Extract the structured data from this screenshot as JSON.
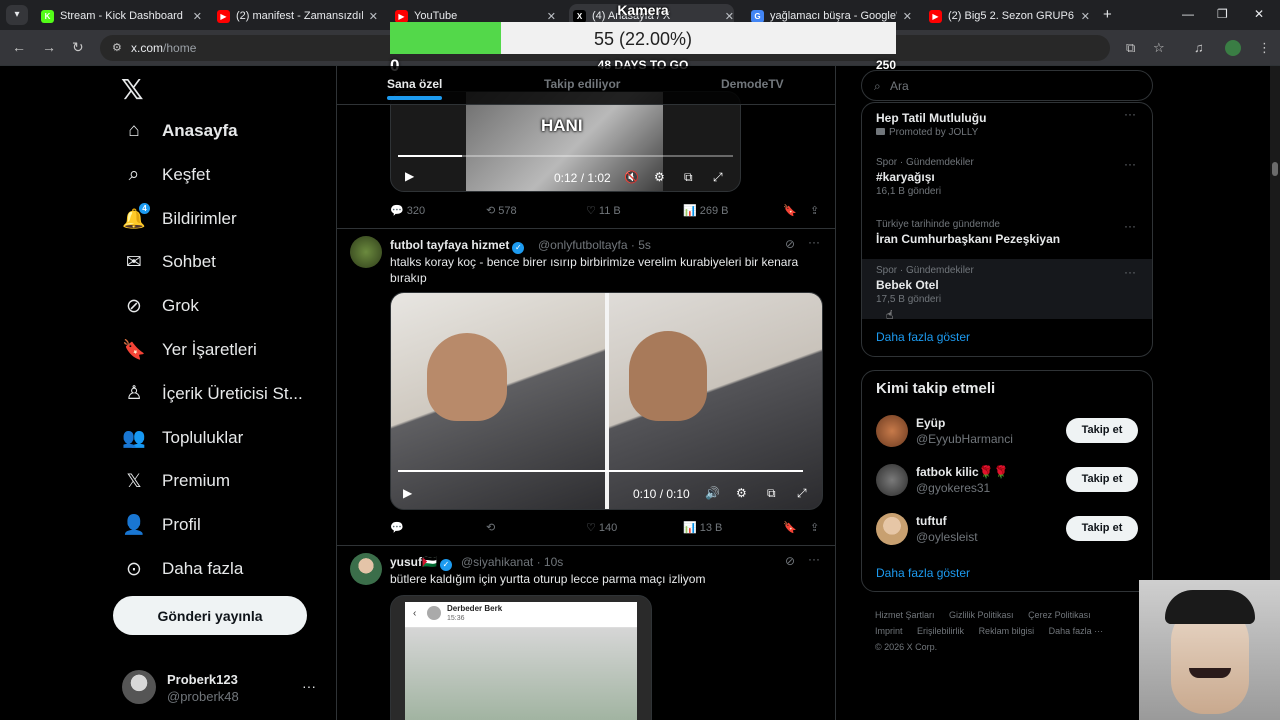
{
  "browser": {
    "tabs": [
      {
        "title": "Stream - Kick Dashboard",
        "fav": "K",
        "fav_color": "#53fc18"
      },
      {
        "title": "(2) manifest - Zamansızdık",
        "fav": "▶",
        "fav_color": "#ff0000"
      },
      {
        "title": "YouTube",
        "fav": "▶",
        "fav_color": "#ff0000"
      },
      {
        "title": "(4) Anasayfa / X",
        "fav": "X",
        "fav_color": "#000000"
      },
      {
        "title": "yağlamacı büşra - Google'da",
        "fav": "G",
        "fav_color": "#4285f4"
      },
      {
        "title": "(2) Big5 2. Sezon GRUP6 S",
        "fav": "▶",
        "fav_color": "#ff0000"
      }
    ],
    "url_host": "x.com",
    "url_path": "/home"
  },
  "sidebar": {
    "items": [
      {
        "label": "Anasayfa",
        "icon": "home-icon"
      },
      {
        "label": "Keşfet",
        "icon": "search-icon"
      },
      {
        "label": "Bildirimler",
        "icon": "bell-icon",
        "badge": "4"
      },
      {
        "label": "Sohbet",
        "icon": "envelope-icon"
      },
      {
        "label": "Grok",
        "icon": "grok-icon"
      },
      {
        "label": "Yer İşaretleri",
        "icon": "bookmark-icon"
      },
      {
        "label": "İçerik Üreticisi St...",
        "icon": "creator-studio-icon"
      },
      {
        "label": "Topluluklar",
        "icon": "communities-icon"
      },
      {
        "label": "Premium",
        "icon": "x-icon"
      },
      {
        "label": "Profil",
        "icon": "profile-icon"
      },
      {
        "label": "Daha fazla",
        "icon": "more-circle-icon"
      }
    ],
    "post_button": "Gönderi yayınla",
    "profile": {
      "name": "Proberk123",
      "handle": "@proberk48"
    }
  },
  "timeline": {
    "tabs": [
      "Sana özel",
      "Takip ediliyor",
      "DemodeTV"
    ],
    "tweet0": {
      "caption_overlay": "HANI",
      "time": "0:12 / 1:02",
      "progress": 0.19,
      "stats": {
        "replies": "320",
        "reposts": "578",
        "likes": "11 B",
        "views": "269 B"
      }
    },
    "tweet1": {
      "name": "futbol tayfaya hizmet",
      "handle": "@onlyfutboltayfa",
      "time": "· 5s",
      "text": "htalks koray koç - bence birer ısırıp birbirimize verelim kurabiyeleri bir kenara bırakıp",
      "video_time": "0:10 / 0:10",
      "progress": 1.0,
      "stats": {
        "replies": "",
        "reposts": "",
        "likes": "140",
        "views": "13 B"
      }
    },
    "tweet2": {
      "name": "yusuf🇵🇸",
      "handle": "@siyahikanat",
      "time": "· 10s",
      "text": "bütlere kaldığım için yurtta oturup lecce parma maçı izliyom",
      "embed_name": "Derbeder Berk",
      "embed_time": "15:36"
    }
  },
  "right": {
    "search_placeholder": "Ara",
    "trends": [
      {
        "meta": "",
        "title": "Hep Tatil Mutluluğu",
        "sub": "Promoted by JOLLY"
      },
      {
        "meta": "Spor · Gündemdekiler",
        "title": "#karyağışı",
        "sub": "16,1 B gönderi"
      },
      {
        "meta": "Türkiye tarihinde gündemde",
        "title": "İran Cumhurbaşkanı Pezeşkiyan",
        "sub": ""
      },
      {
        "meta": "Spor · Gündemdekiler",
        "title": "Bebek Otel",
        "sub": "17,5 B gönderi"
      }
    ],
    "show_more": "Daha fazla göster",
    "who_to_follow": {
      "title": "Kimi takip etmeli",
      "users": [
        {
          "name": "Eyüp",
          "handle": "@EyyubHarmanci",
          "button": "Takip et"
        },
        {
          "name": "fatbok kilic🌹🌹",
          "handle": "@gyokeres31",
          "button": "Takip et"
        },
        {
          "name": "tuftuf",
          "handle": "@oylesleist",
          "button": "Takip et"
        }
      ],
      "show_more": "Daha fazla göster"
    },
    "footer": [
      "Hizmet Şartları",
      "Gizlilik Politikası",
      "Çerez Politikası",
      "Imprint",
      "Erişilebilirlik",
      "Reklam bilgisi",
      "Daha fazla ···",
      "© 2026 X Corp."
    ]
  },
  "overlay": {
    "goal_title": "Kamera",
    "goal_label": "55 (22.00%)",
    "goal_fraction": 0.22,
    "goal_min": "0",
    "goal_days": "48 DAYS TO GO",
    "goal_max": "250"
  }
}
